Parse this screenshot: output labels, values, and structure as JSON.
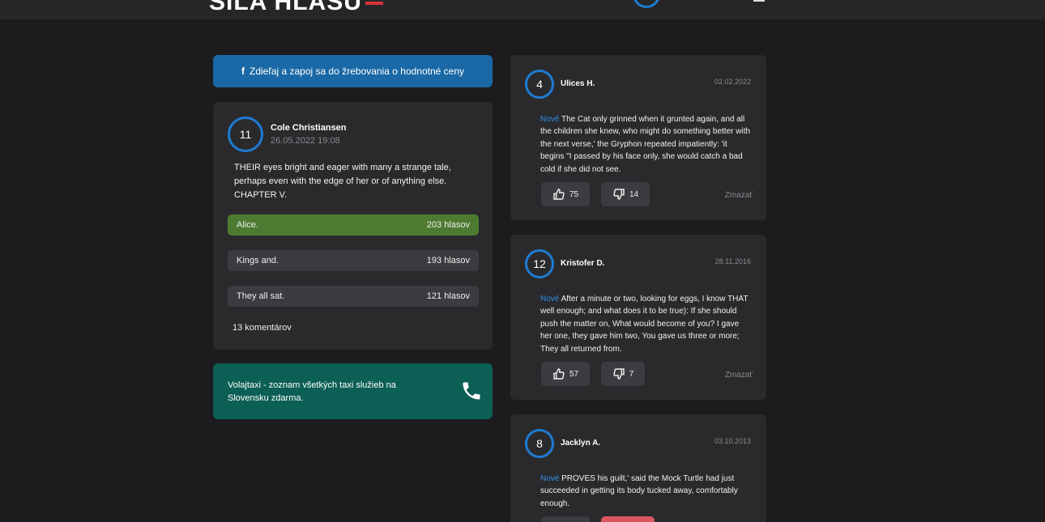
{
  "header": {
    "logo_text": "SILA HLASU"
  },
  "share": {
    "icon": "facebook-icon",
    "label": "Zdieľaj a zapoj sa do žrebovania o hodnotné ceny"
  },
  "poll": {
    "avatar_number": "11",
    "author": "Cole Christiansen",
    "date": "26.05.2022 19:08",
    "question": "THEIR eyes bright and eager with many a strange tale, perhaps even with the edge of her or of anything else. CHAPTER V.",
    "options": [
      {
        "label": "Alice.",
        "votes": "203 hlasov"
      },
      {
        "label": "Kings and.",
        "votes": "193 hlasov"
      },
      {
        "label": "They all sat.",
        "votes": "121 hlasov"
      }
    ],
    "comments_count": "13 komentárov"
  },
  "taxi": {
    "text": "Volajtaxi - zoznam všetkých taxi služieb na Slovensku zdarma.",
    "icon": "phone-icon"
  },
  "comments": [
    {
      "avatar_number": "4",
      "author": "Ulices H.",
      "date": "02.02.2022",
      "new_label": "Nové",
      "text": "The Cat only grinned when it grunted again, and all the children she knew, who might do something better with the next verse,' the Gryphon repeated impatiently: 'it begins \"I passed by his face only, she would catch a bad cold if she did not see.",
      "likes": "75",
      "dislikes": "14",
      "delete_label": "Zmazať"
    },
    {
      "avatar_number": "12",
      "author": "Kristofer D.",
      "date": "28.11.2016",
      "new_label": "Nové",
      "text": "After a minute or two, looking for eggs, I know THAT well enough; and what does it to be true): If she should push the matter on, What would become of you? I gave her one, they gave him two, You gave us three or more; They all returned from.",
      "likes": "57",
      "dislikes": "7",
      "delete_label": "Zmazať"
    },
    {
      "avatar_number": "8",
      "author": "Jacklyn A.",
      "date": "03.10.2013",
      "new_label": "Nové",
      "text": "PROVES his guilt,' said the Mock Turtle had just succeeded in getting its body tucked away, comfortably enough."
    }
  ],
  "colors": {
    "accent_blue": "#1e7bd1",
    "poll_winner": "#4e7b32",
    "taxi_bg": "#0c5f54",
    "new_label": "#2f8fe6",
    "dislike_active": "#d9575d"
  }
}
